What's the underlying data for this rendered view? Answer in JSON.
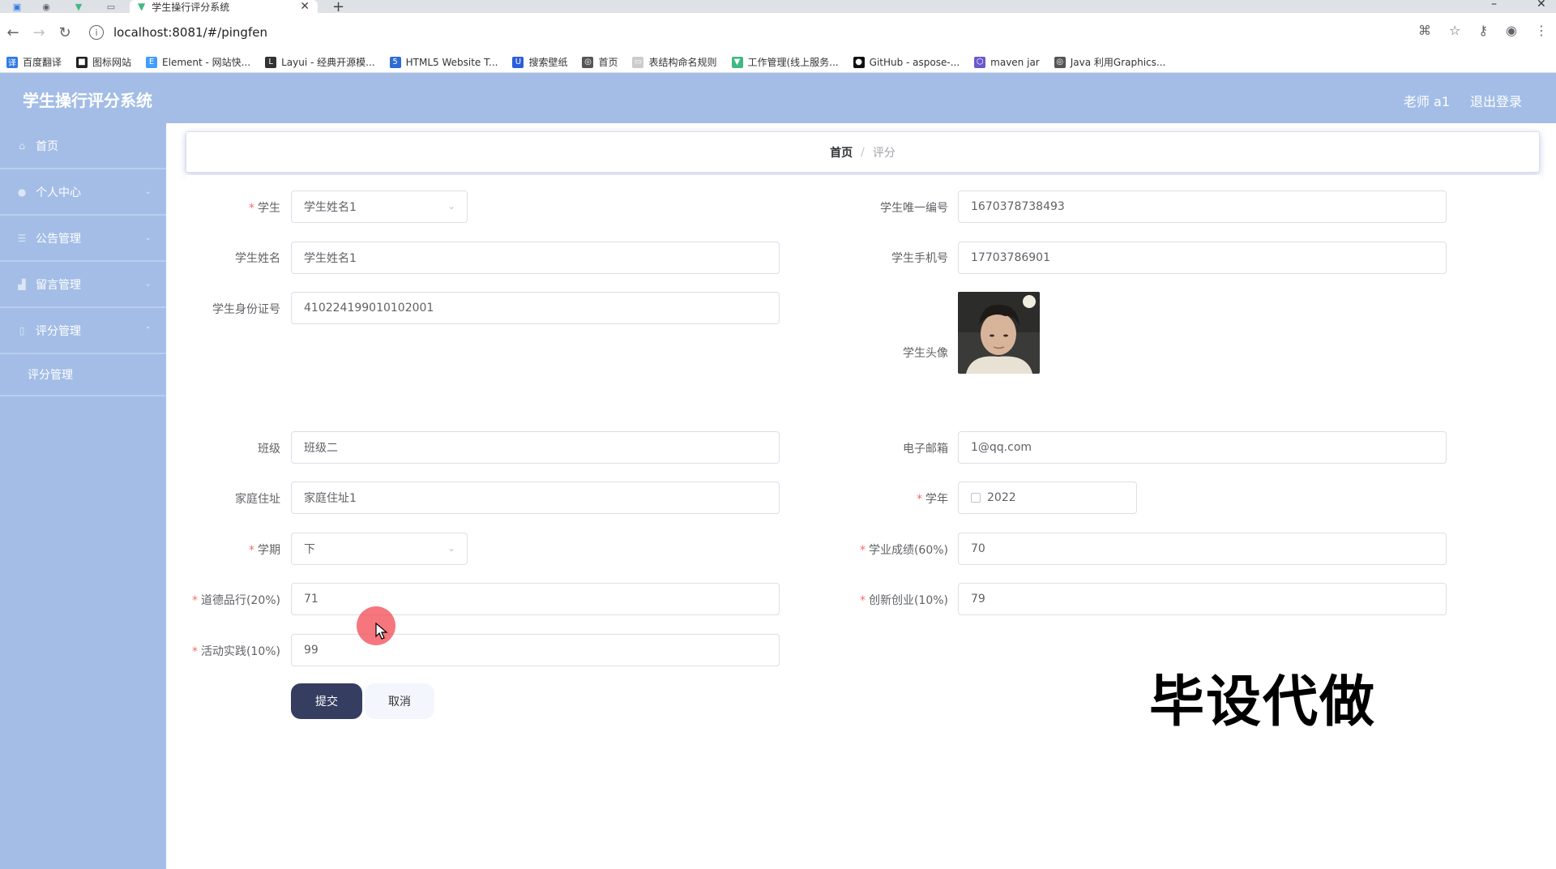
{
  "browser": {
    "tab_title": "学生操行评分系统",
    "url": "localhost:8081/#/pingfen",
    "bookmarks": [
      {
        "label": "百度翻译",
        "icon": "baidu-translate-icon",
        "color": "#2f7ae5"
      },
      {
        "label": "图标网站",
        "icon": "iconfont-icon",
        "color": "#222222"
      },
      {
        "label": "Element - 网站快...",
        "icon": "element-icon",
        "color": "#409eff"
      },
      {
        "label": "Layui - 经典开源模...",
        "icon": "layui-icon",
        "color": "#333333"
      },
      {
        "label": "HTML5 Website T...",
        "icon": "html5-icon",
        "color": "#2d6bd6"
      },
      {
        "label": "搜索壁纸",
        "icon": "wallpaper-icon",
        "color": "#2b5fd9"
      },
      {
        "label": "首页",
        "icon": "globe-icon",
        "color": "#555555"
      },
      {
        "label": "表结构命名规则",
        "icon": "doc-icon",
        "color": "#cccccc"
      },
      {
        "label": "工作管理(线上服务...",
        "icon": "vue-icon",
        "color": "#41b883"
      },
      {
        "label": "GitHub - aspose-...",
        "icon": "github-icon",
        "color": "#111111"
      },
      {
        "label": "maven jar",
        "icon": "maven-icon",
        "color": "#6a5acd"
      },
      {
        "label": "Java 利用Graphics...",
        "icon": "globe-icon",
        "color": "#555555"
      }
    ]
  },
  "header": {
    "title": "学生操行评分系统",
    "user": "老师 a1",
    "logout": "退出登录"
  },
  "sidebar": {
    "items": [
      {
        "label": "首页",
        "icon": "home-icon"
      },
      {
        "label": "个人中心",
        "icon": "user-icon"
      },
      {
        "label": "公告管理",
        "icon": "list-icon"
      },
      {
        "label": "留言管理",
        "icon": "message-icon"
      },
      {
        "label": "评分管理",
        "icon": "score-icon"
      }
    ],
    "sub_item": "评分管理"
  },
  "breadcrumb": {
    "home": "首页",
    "separator": "/",
    "current": "评分"
  },
  "form": {
    "student": {
      "label": "学生",
      "value": "学生姓名1"
    },
    "student_no": {
      "label": "学生唯一编号",
      "value": "1670378738493"
    },
    "student_name": {
      "label": "学生姓名",
      "value": "学生姓名1"
    },
    "student_phone": {
      "label": "学生手机号",
      "value": "17703786901"
    },
    "id_card": {
      "label": "学生身份证号",
      "value": "410224199010102001"
    },
    "avatar": {
      "label": "学生头像"
    },
    "class": {
      "label": "班级",
      "value": "班级二"
    },
    "email": {
      "label": "电子邮箱",
      "value": "1@qq.com"
    },
    "address": {
      "label": "家庭住址",
      "value": "家庭住址1"
    },
    "year": {
      "label": "学年",
      "value": "2022"
    },
    "semester": {
      "label": "学期",
      "value": "下"
    },
    "academic": {
      "label": "学业成绩(60%)",
      "value": "70"
    },
    "moral": {
      "label": "道德品行(20%)",
      "value": "71"
    },
    "innovation": {
      "label": "创新创业(10%)",
      "value": "79"
    },
    "activity": {
      "label": "活动实践(10%)",
      "value": "99"
    },
    "required_mark": "*",
    "submit": "提交",
    "cancel": "取消"
  },
  "watermark": "毕设代做",
  "colors": {
    "header_bg": "#a3bde6",
    "submit_bg": "#353d60",
    "required": "#f56c6c"
  }
}
